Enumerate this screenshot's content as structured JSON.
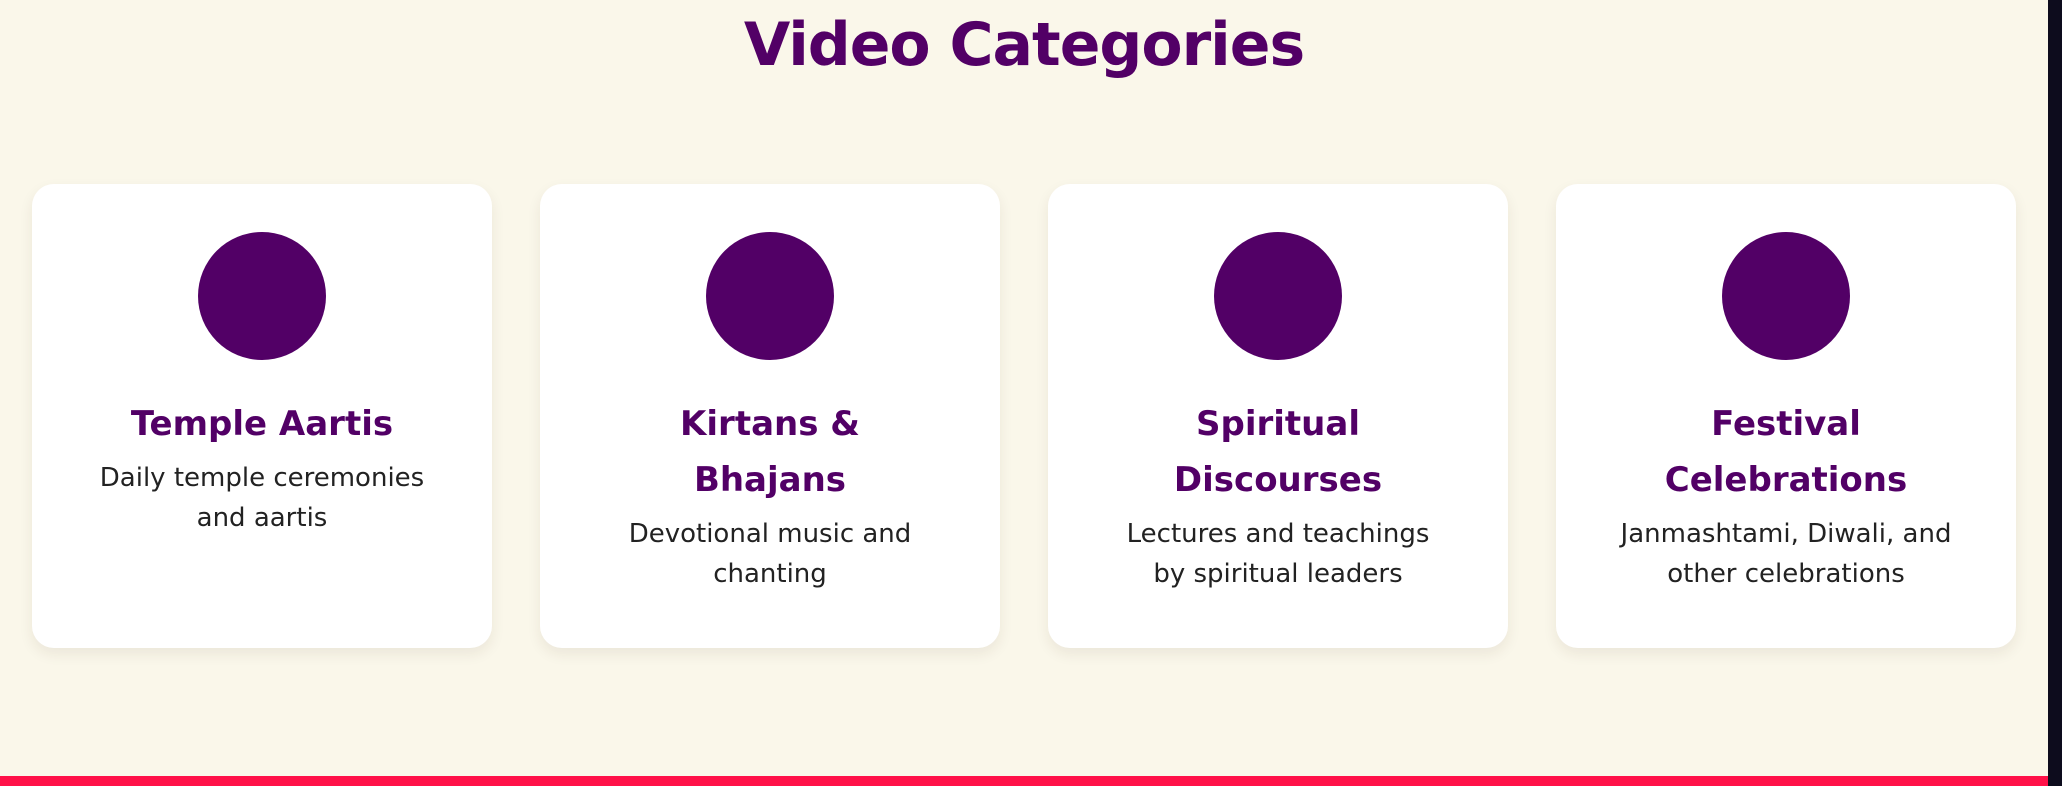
{
  "section": {
    "title": "Video Categories"
  },
  "categories": [
    {
      "title": "Temple Aartis",
      "description": "Daily temple ceremonies and aartis"
    },
    {
      "title": "Kirtans & Bhajans",
      "description": "Devotional music and chanting"
    },
    {
      "title": "Spiritual Discourses",
      "description": "Lectures and teachings by spiritual leaders"
    },
    {
      "title": "Festival Celebrations",
      "description": "Janmashtami, Diwali, and other celebrations"
    }
  ],
  "colors": {
    "accent": "#520066",
    "background": "#faf7ea",
    "card": "#ffffff",
    "bottom_bar": "#ff1148"
  }
}
